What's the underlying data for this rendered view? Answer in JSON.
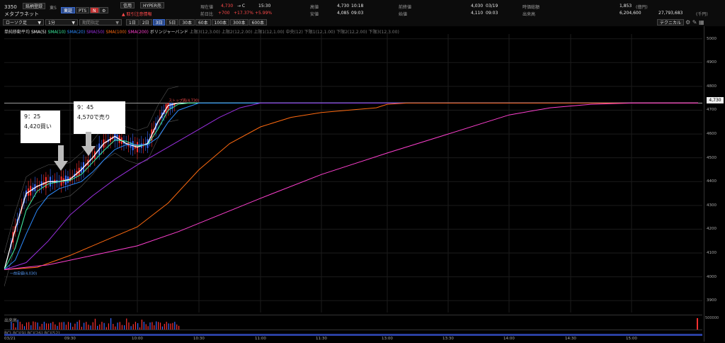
{
  "header": {
    "code": "3350",
    "name": "メタプラネット",
    "buttons": [
      "銘柄登録",
      "東S",
      "東証",
      "PTS",
      "N",
      "⚙"
    ],
    "credit_label": "信用",
    "hyper_label": "HYPER売",
    "warning_label": "取引注意情報",
    "current_label": "現在値",
    "current_value": "4,730",
    "current_mark": "→ C",
    "current_time": "15:30",
    "change_label": "前日比",
    "change_value": "+700",
    "change_value2": "+17.37%",
    "change_value3": "+5.99%",
    "high_label": "高値",
    "high_value": "4,730",
    "high_time": "10:18",
    "low_label": "安値",
    "low_value": "4,085",
    "low_time": "09:03",
    "prev_label": "前終値",
    "prev_value": "4,030",
    "prev_date": "03/19",
    "open_label": "始値",
    "open_value": "4,110",
    "open_time": "09:03",
    "mcap_label": "時価総額",
    "mcap_value": "1,853",
    "mcap_unit": "(億円)",
    "vol_label": "出来高",
    "vol_value": "6,204,600",
    "turnover_value": "27,793,683",
    "turnover_unit": "(千円)"
  },
  "toolbar": {
    "chart_type": "ローソク足",
    "interval": "1分",
    "range": "期間指定",
    "periods": [
      "1日",
      "2日",
      "3日",
      "5日",
      "30本",
      "60本",
      "100本",
      "300本",
      "600本"
    ],
    "active_period": "3日",
    "tech_label": "テクニカル"
  },
  "indicators": {
    "ma_label": "単純移動平均",
    "sma5": "SMA(5)",
    "sma10": "SMA(10)",
    "sma20": "SMA(20)",
    "sma50": "SMA(50)",
    "sma100": "SMA(100)",
    "sma200": "SMA(200)",
    "bb_label": "ボリンジャーバンド",
    "bb_items": "上限3(12,3.00)  上限2(12,2.00)  上限1(12,1.00)  中央(12)  下限1(12,1.00)  下限2(12,2.00)  下限3(12,3.00)"
  },
  "annotations": [
    {
      "time": "9：25",
      "text": "4,420買い"
    },
    {
      "time": "9：45",
      "text": "4,570で売り"
    }
  ],
  "chart_labels": {
    "limit_high": "ストップ高(4,730",
    "limit_low": "一前安値(4,030",
    "price_marker": "4,730"
  },
  "volume": {
    "label": "出来高",
    "scale": "500000"
  },
  "rci": {
    "label": "RCI",
    "items": "RCI(9)  RCI(26)  RCI(52)"
  },
  "colors": {
    "sma5": "#ffffff",
    "sma10": "#3cf0a0",
    "sma20": "#2d8cff",
    "sma50": "#9a30e0",
    "sma100": "#ff6a10",
    "sma200": "#ff40d0",
    "up": "#ff3030",
    "down": "#3a6aff"
  },
  "chart_data": {
    "type": "line",
    "title": "",
    "xlabel": "",
    "ylabel": "",
    "ylim": [
      3850,
      5020
    ],
    "y_ticks": [
      3900,
      4000,
      4100,
      4200,
      4300,
      4400,
      4500,
      4600,
      4700,
      4800,
      4900,
      5000
    ],
    "x_tick_labels": [
      "03/21",
      "09:30",
      "10:00",
      "10:30",
      "11:00",
      "11:30",
      "13:00",
      "13:30",
      "14:00",
      "14:30",
      "15:00"
    ],
    "x_range": [
      "09:00",
      "15:30"
    ],
    "series": [
      {
        "name": "SMA(5)",
        "points": [
          [
            "09:00",
            4030
          ],
          [
            "09:05",
            4200
          ],
          [
            "09:10",
            4350
          ],
          [
            "09:15",
            4380
          ],
          [
            "09:20",
            4400
          ],
          [
            "09:25",
            4400
          ],
          [
            "09:30",
            4410
          ],
          [
            "09:35",
            4450
          ],
          [
            "09:40",
            4500
          ],
          [
            "09:45",
            4560
          ],
          [
            "09:50",
            4590
          ],
          [
            "09:55",
            4560
          ],
          [
            "10:00",
            4545
          ],
          [
            "10:05",
            4560
          ],
          [
            "10:10",
            4650
          ],
          [
            "10:15",
            4720
          ],
          [
            "10:20",
            4730
          ],
          [
            "15:30",
            4730
          ]
        ]
      },
      {
        "name": "SMA(10)",
        "points": [
          [
            "09:00",
            4030
          ],
          [
            "09:05",
            4120
          ],
          [
            "09:10",
            4280
          ],
          [
            "09:15",
            4360
          ],
          [
            "09:20",
            4390
          ],
          [
            "09:25",
            4400
          ],
          [
            "09:30",
            4405
          ],
          [
            "09:35",
            4430
          ],
          [
            "09:40",
            4480
          ],
          [
            "09:45",
            4530
          ],
          [
            "09:50",
            4575
          ],
          [
            "09:55",
            4570
          ],
          [
            "10:00",
            4550
          ],
          [
            "10:05",
            4555
          ],
          [
            "10:10",
            4620
          ],
          [
            "10:15",
            4700
          ],
          [
            "10:20",
            4725
          ],
          [
            "10:25",
            4730
          ],
          [
            "15:30",
            4730
          ]
        ]
      },
      {
        "name": "SMA(20)",
        "points": [
          [
            "09:00",
            4030
          ],
          [
            "09:05",
            4070
          ],
          [
            "09:10",
            4180
          ],
          [
            "09:15",
            4280
          ],
          [
            "09:20",
            4340
          ],
          [
            "09:25",
            4370
          ],
          [
            "09:30",
            4385
          ],
          [
            "09:35",
            4400
          ],
          [
            "09:40",
            4440
          ],
          [
            "09:45",
            4490
          ],
          [
            "09:50",
            4535
          ],
          [
            "09:55",
            4555
          ],
          [
            "10:00",
            4555
          ],
          [
            "10:05",
            4555
          ],
          [
            "10:10",
            4585
          ],
          [
            "10:15",
            4650
          ],
          [
            "10:20",
            4700
          ],
          [
            "10:30",
            4730
          ],
          [
            "15:30",
            4730
          ]
        ]
      },
      {
        "name": "SMA(50)",
        "points": [
          [
            "09:00",
            4030
          ],
          [
            "09:10",
            4060
          ],
          [
            "09:20",
            4150
          ],
          [
            "09:30",
            4260
          ],
          [
            "09:40",
            4340
          ],
          [
            "09:50",
            4410
          ],
          [
            "10:00",
            4470
          ],
          [
            "10:10",
            4520
          ],
          [
            "10:20",
            4570
          ],
          [
            "10:30",
            4620
          ],
          [
            "10:40",
            4670
          ],
          [
            "10:50",
            4710
          ],
          [
            "11:00",
            4730
          ],
          [
            "15:30",
            4730
          ]
        ]
      },
      {
        "name": "SMA(100)",
        "points": [
          [
            "09:00",
            4030
          ],
          [
            "09:15",
            4040
          ],
          [
            "09:30",
            4090
          ],
          [
            "09:45",
            4150
          ],
          [
            "10:00",
            4210
          ],
          [
            "10:15",
            4310
          ],
          [
            "10:30",
            4450
          ],
          [
            "10:45",
            4560
          ],
          [
            "11:00",
            4630
          ],
          [
            "11:15",
            4670
          ],
          [
            "11:30",
            4690
          ],
          [
            "12:45",
            4710
          ],
          [
            "13:00",
            4725
          ],
          [
            "13:10",
            4730
          ],
          [
            "15:30",
            4730
          ]
        ]
      },
      {
        "name": "SMA(200)",
        "points": [
          [
            "09:00",
            4030
          ],
          [
            "09:20",
            4050
          ],
          [
            "09:40",
            4090
          ],
          [
            "10:00",
            4130
          ],
          [
            "10:20",
            4190
          ],
          [
            "10:40",
            4260
          ],
          [
            "11:00",
            4330
          ],
          [
            "11:30",
            4430
          ],
          [
            "13:00",
            4520
          ],
          [
            "13:30",
            4600
          ],
          [
            "14:00",
            4680
          ],
          [
            "14:20",
            4710
          ],
          [
            "14:40",
            4725
          ],
          [
            "15:00",
            4730
          ],
          [
            "15:30",
            4730
          ]
        ]
      }
    ]
  }
}
